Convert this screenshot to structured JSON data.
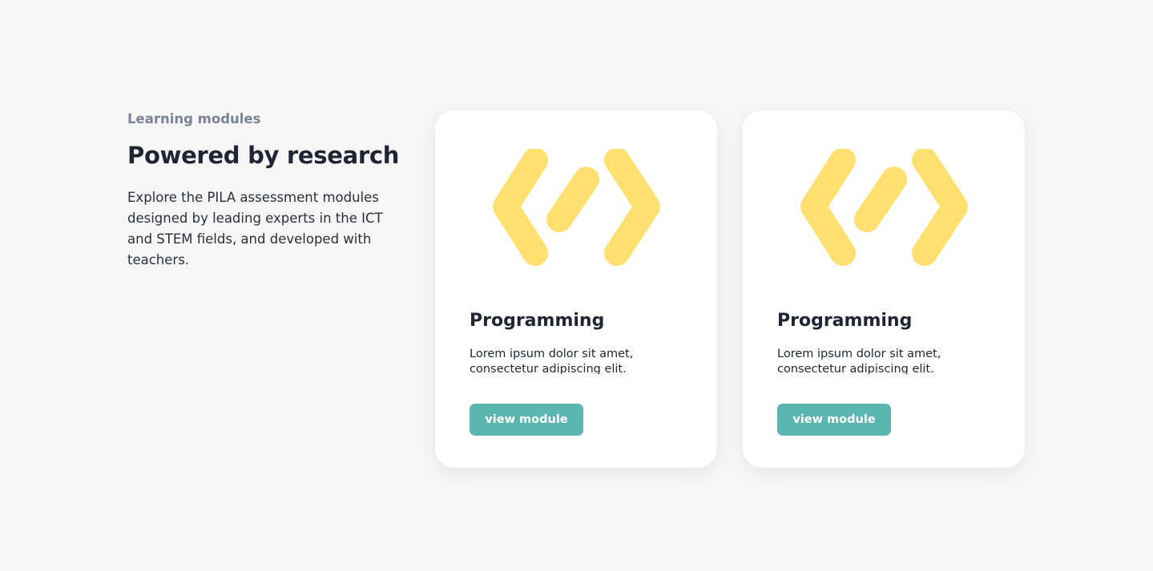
{
  "intro": {
    "eyebrow": "Learning modules",
    "heading": "Powered by research",
    "description": "Explore the PILA assessment modules designed by leading experts in the ICT and STEM fields, and developed with teachers."
  },
  "cards": [
    {
      "icon": "code-brackets-icon",
      "title": "Programming",
      "text": "Lorem ipsum dolor sit amet, consectetur adipiscing elit.",
      "button_label": "view module"
    },
    {
      "icon": "code-brackets-icon",
      "title": "Programming",
      "text": "Lorem ipsum dolor sit amet, consectetur adipiscing elit.",
      "button_label": "view module"
    }
  ],
  "colors": {
    "background": "#f6f6f6",
    "icon": "#ffe070",
    "button": "#5bb5b0",
    "heading": "#1f2533",
    "eyebrow": "#7a8494"
  }
}
